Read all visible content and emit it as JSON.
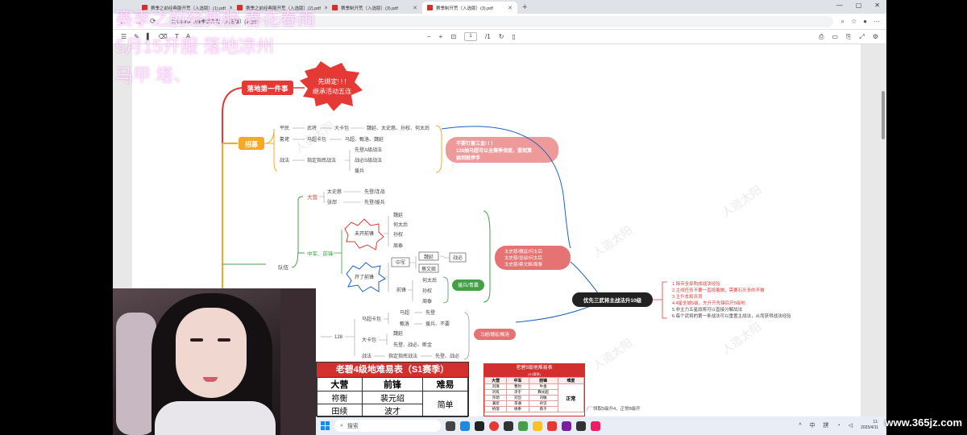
{
  "overlay": {
    "line1": "赛季之前经典服 春花春雨",
    "line2": "5月15开服    落地凉州",
    "line3": "马甲 塔、"
  },
  "browser": {
    "tabs": [
      {
        "label": "赛季之前经典服开荒（入选版）(1).pdf",
        "active": false
      },
      {
        "label": "赛季之前经典服开荒（入选版）(2).pdf",
        "active": false
      },
      {
        "label": "赛季制开荒（入选版）(3).pdf",
        "active": false
      },
      {
        "label": "赛季制开荒（入选版）(3).pdf",
        "active": true
      }
    ],
    "url": "C:/Users/.../赛季制开荒（入选版）(3).pdf",
    "page_current": "1",
    "page_total": "/1"
  },
  "mindmap": {
    "landing": "落地第一件事",
    "burst_1": "先绑定! ! !",
    "burst_2": "继承活动五连",
    "recruit": "招募",
    "pinggan": "平民",
    "wujiang": "武将",
    "dakabao": "大卡包",
    "pg_result": "魏延、太史慈、孙权、何太后",
    "jiyuan": "氪佬",
    "mache_kabao": "马超卡包",
    "jy_result": "马超、甄洛、魏延",
    "zhanfa": "战法",
    "zhiding": "指定指挥战法",
    "zf_1": "先登A级战法",
    "zf_2": "战必S级战法",
    "zf_3": "援兵",
    "note_1": "不要钉着三金! ! !",
    "note_2": "128抽马超可以全赛季保底，要到算",
    "note_3": "抽到就停手",
    "team": "队伍",
    "daying": "大营",
    "dy_1": "太史慈",
    "dy_1r": "先登/连战",
    "dy_2": "张郃",
    "dy_2r": "先登/援兵",
    "zhongjun": "中军、前锋",
    "weikai": "未开前锋",
    "wk_1": "魏延",
    "wk_2": "何太后",
    "wk_3": "孙权",
    "wk_4": "周泰",
    "kaile": "开了前锋",
    "zhong": "中军",
    "z_1": "魏延",
    "z_2": "蔡文姬",
    "z_r": "战必",
    "qianfeng": "前锋",
    "q_1": "何太后",
    "q_2": "孙权",
    "q_3": "周泰",
    "q_r": "援兵/青囊",
    "pill_1": "太史慈/魏延/何太后",
    "pill_2": "太史慈/张郃/何太后",
    "pill_3": "太史慈/蔡文姬/周泰",
    "priority": "优先三武将主战法升10级",
    "n128": "128",
    "b_mc": "马超卡包",
    "b_mc1": "马超",
    "b_mc1r": "先登",
    "b_mc2": "甄洛",
    "b_mc2r": "援兵、不要",
    "b_dk": "大卡包",
    "b_dk1": "魏延",
    "b_dk2": "先登、战必、断金",
    "b_zf": "战法",
    "b_zf1": "指定指挥战法",
    "b_zf1r": "先登、战必",
    "pill_4": "马超/魏延/甄洛",
    "tips": [
      "1.除币全部购成战法经验",
      "2.主线任务不要一直按着做，需要石头多的不做",
      "3.主升本和兵员",
      "4.4星全城5级，先升开先锋后开5级地",
      "5.非主力五星战将可以直接分解战法",
      "6.每个武将的第一条战法可以重置主战法，从而获得战法经验"
    ],
    "bottom_note": "领取5级升4、正常8级开",
    "watermark_text": "人造太阳"
  },
  "table_s1": {
    "title": "老碧4级地难易表（S1赛季）",
    "headers": [
      "大营",
      "前锋",
      "难易"
    ],
    "rows": [
      [
        "祢衡",
        "裴元绍",
        "简单"
      ],
      [
        "田续",
        "波才",
        ""
      ]
    ]
  },
  "table_s5": {
    "title": "老碧5级地难易表",
    "subtitle": "(S1赛季)",
    "headers": [
      "大营",
      "中军",
      "前锋",
      "难度"
    ],
    "rows": [
      [
        "刘璋",
        "曹豹",
        "牛金",
        ""
      ],
      [
        "刘焉",
        "淳于",
        "麴光超",
        "正常"
      ],
      [
        "许劭",
        "刘岱",
        "刘敏",
        ""
      ],
      [
        "满宠",
        "李通",
        "孙坚",
        ""
      ],
      [
        "桥瑁",
        "杨奉",
        "蒋干",
        ""
      ]
    ]
  },
  "taskbar": {
    "search_placeholder": "搜索",
    "lang": "中",
    "ime": "拼",
    "time": "11:",
    "date": "2025/4/11"
  },
  "site_watermark": "www.365jz.com",
  "colors": {
    "red": "#e53935",
    "orange": "#f9a825",
    "green": "#43a047",
    "blue": "#1e5fbf",
    "salmon": "#e57373"
  }
}
